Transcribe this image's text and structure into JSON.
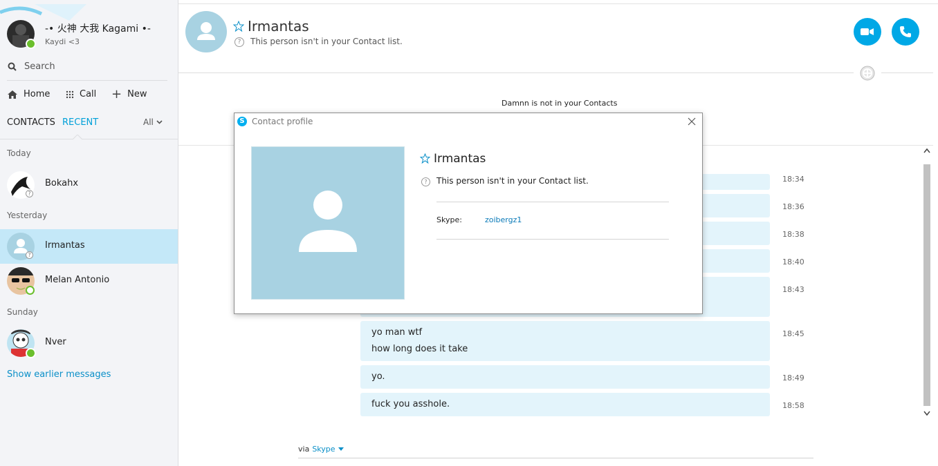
{
  "profile": {
    "name": "-• 火神 大我 Kagami •-",
    "mood": "Kaydi <3"
  },
  "search": {
    "placeholder": "Search"
  },
  "nav": {
    "home": "Home",
    "call": "Call",
    "new": "New"
  },
  "tabs": {
    "contacts": "CONTACTS",
    "recent": "RECENT",
    "filter": "All"
  },
  "sections": {
    "today": "Today",
    "yesterday": "Yesterday",
    "sunday": "Sunday"
  },
  "contacts": [
    {
      "name": "Bokahx",
      "status": "unknown"
    },
    {
      "name": "Irmantas",
      "status": "unknown",
      "selected": true
    },
    {
      "name": "Melan Antonio",
      "status": "online-outline"
    },
    {
      "name": "Nver",
      "status": "online"
    }
  ],
  "show_earlier": "Show earlier messages",
  "header": {
    "name": "Irmantas",
    "subtitle": "This person isn't in your Contact list."
  },
  "notice": "Damnn is not in your Contacts",
  "messages": [
    {
      "time": "18:34"
    },
    {
      "time": "18:36"
    },
    {
      "time": "18:38"
    },
    {
      "time": "18:40"
    },
    {
      "time": "18:43"
    },
    {
      "time": "18:45",
      "lines": [
        "yo man wtf",
        "how long does it take"
      ]
    },
    {
      "time": "18:49",
      "lines": [
        "yo."
      ]
    },
    {
      "time": "18:58",
      "lines": [
        "fuck you asshole."
      ]
    }
  ],
  "footer": {
    "via": "via",
    "service": "Skype"
  },
  "dialog": {
    "title": "Contact profile",
    "name": "Irmantas",
    "status": "This person isn't in your Contact list.",
    "skype_label": "Skype:",
    "skype_value": "zoibergz1"
  },
  "colors": {
    "accent": "#00a8e6",
    "selected_row": "#c4e8f8",
    "bubble": "#e3f4fb",
    "avatar_placeholder": "#a8d2e2",
    "online": "#6bbf2d"
  }
}
